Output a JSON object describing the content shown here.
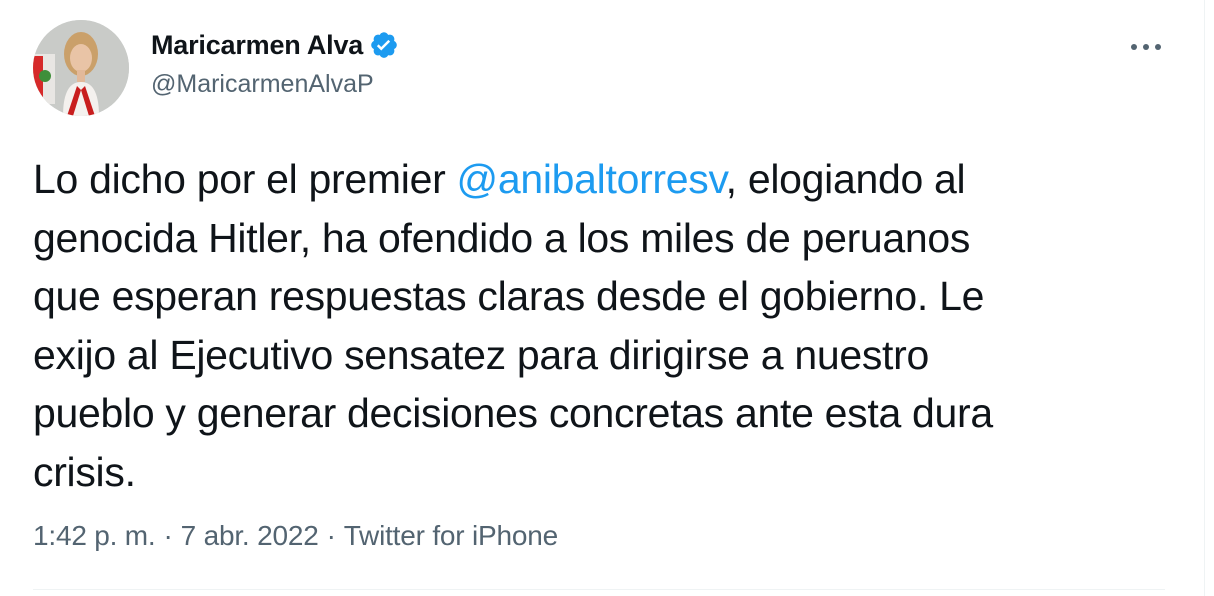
{
  "author": {
    "display_name": "Maricarmen Alva",
    "handle": "@MaricarmenAlvaP",
    "verified": true,
    "avatar_icon": "profile-photo"
  },
  "tweet": {
    "lines": [
      {
        "before": "Lo dicho por el premier ",
        "mention": "@anibaltorresv",
        "after": ", elogiando al"
      },
      {
        "text": "genocida Hitler, ha ofendido a los miles de peruanos"
      },
      {
        "text": "que esperan respuestas claras desde el gobierno. Le"
      },
      {
        "text": "exijo al Ejecutivo sensatez para dirigirse a nuestro"
      },
      {
        "text": "pueblo y generar decisiones concretas ante esta dura"
      },
      {
        "text": "crisis."
      }
    ]
  },
  "meta": {
    "time": "1:42 p. m.",
    "separator": "·",
    "date": "7 abr. 2022",
    "source": "Twitter for iPhone"
  },
  "icons": {
    "verified": "verified-badge-icon",
    "more": "more-options-icon"
  },
  "colors": {
    "accent": "#1d9bf0",
    "text": "#0f1419",
    "secondary": "#536471"
  }
}
